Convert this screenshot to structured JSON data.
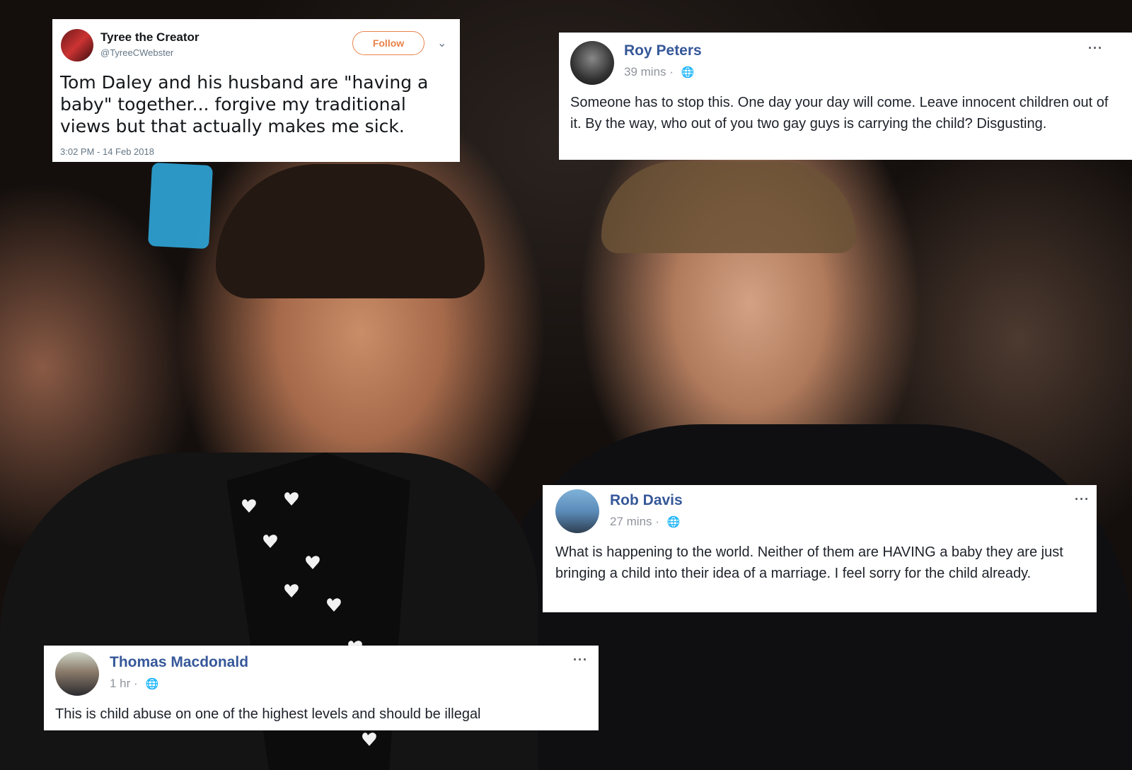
{
  "tweet": {
    "display_name": "Tyree the Creator",
    "handle": "@TyreeCWebster",
    "follow_label": "Follow",
    "text": "Tom Daley and his husband are \"having a baby\" together... forgive my traditional views but that actually makes me sick.",
    "timestamp": "3:02 PM - 14 Feb 2018"
  },
  "comments": [
    {
      "name": "Roy Peters",
      "time": "39 mins",
      "text": "Someone has to stop this. One day your day will come. Leave innocent children out of it. By the way, who out of you two gay guys is carrying the child? Disgusting."
    },
    {
      "name": "Rob Davis",
      "time": "27 mins",
      "text": "What is happening to the world. Neither of them are HAVING a baby they are just bringing a child into their idea of a marriage. I feel sorry for the child already."
    },
    {
      "name": "Thomas Macdonald",
      "time": "1 hr",
      "text": "This is child abuse on one of the highest levels and should be illegal"
    }
  ],
  "ui": {
    "meta_separator": "·",
    "globe_glyph": "🌐",
    "more_glyph": "···",
    "chevron_glyph": "⌄",
    "follow_color": "#e8824a",
    "fb_name_color": "#365899"
  }
}
